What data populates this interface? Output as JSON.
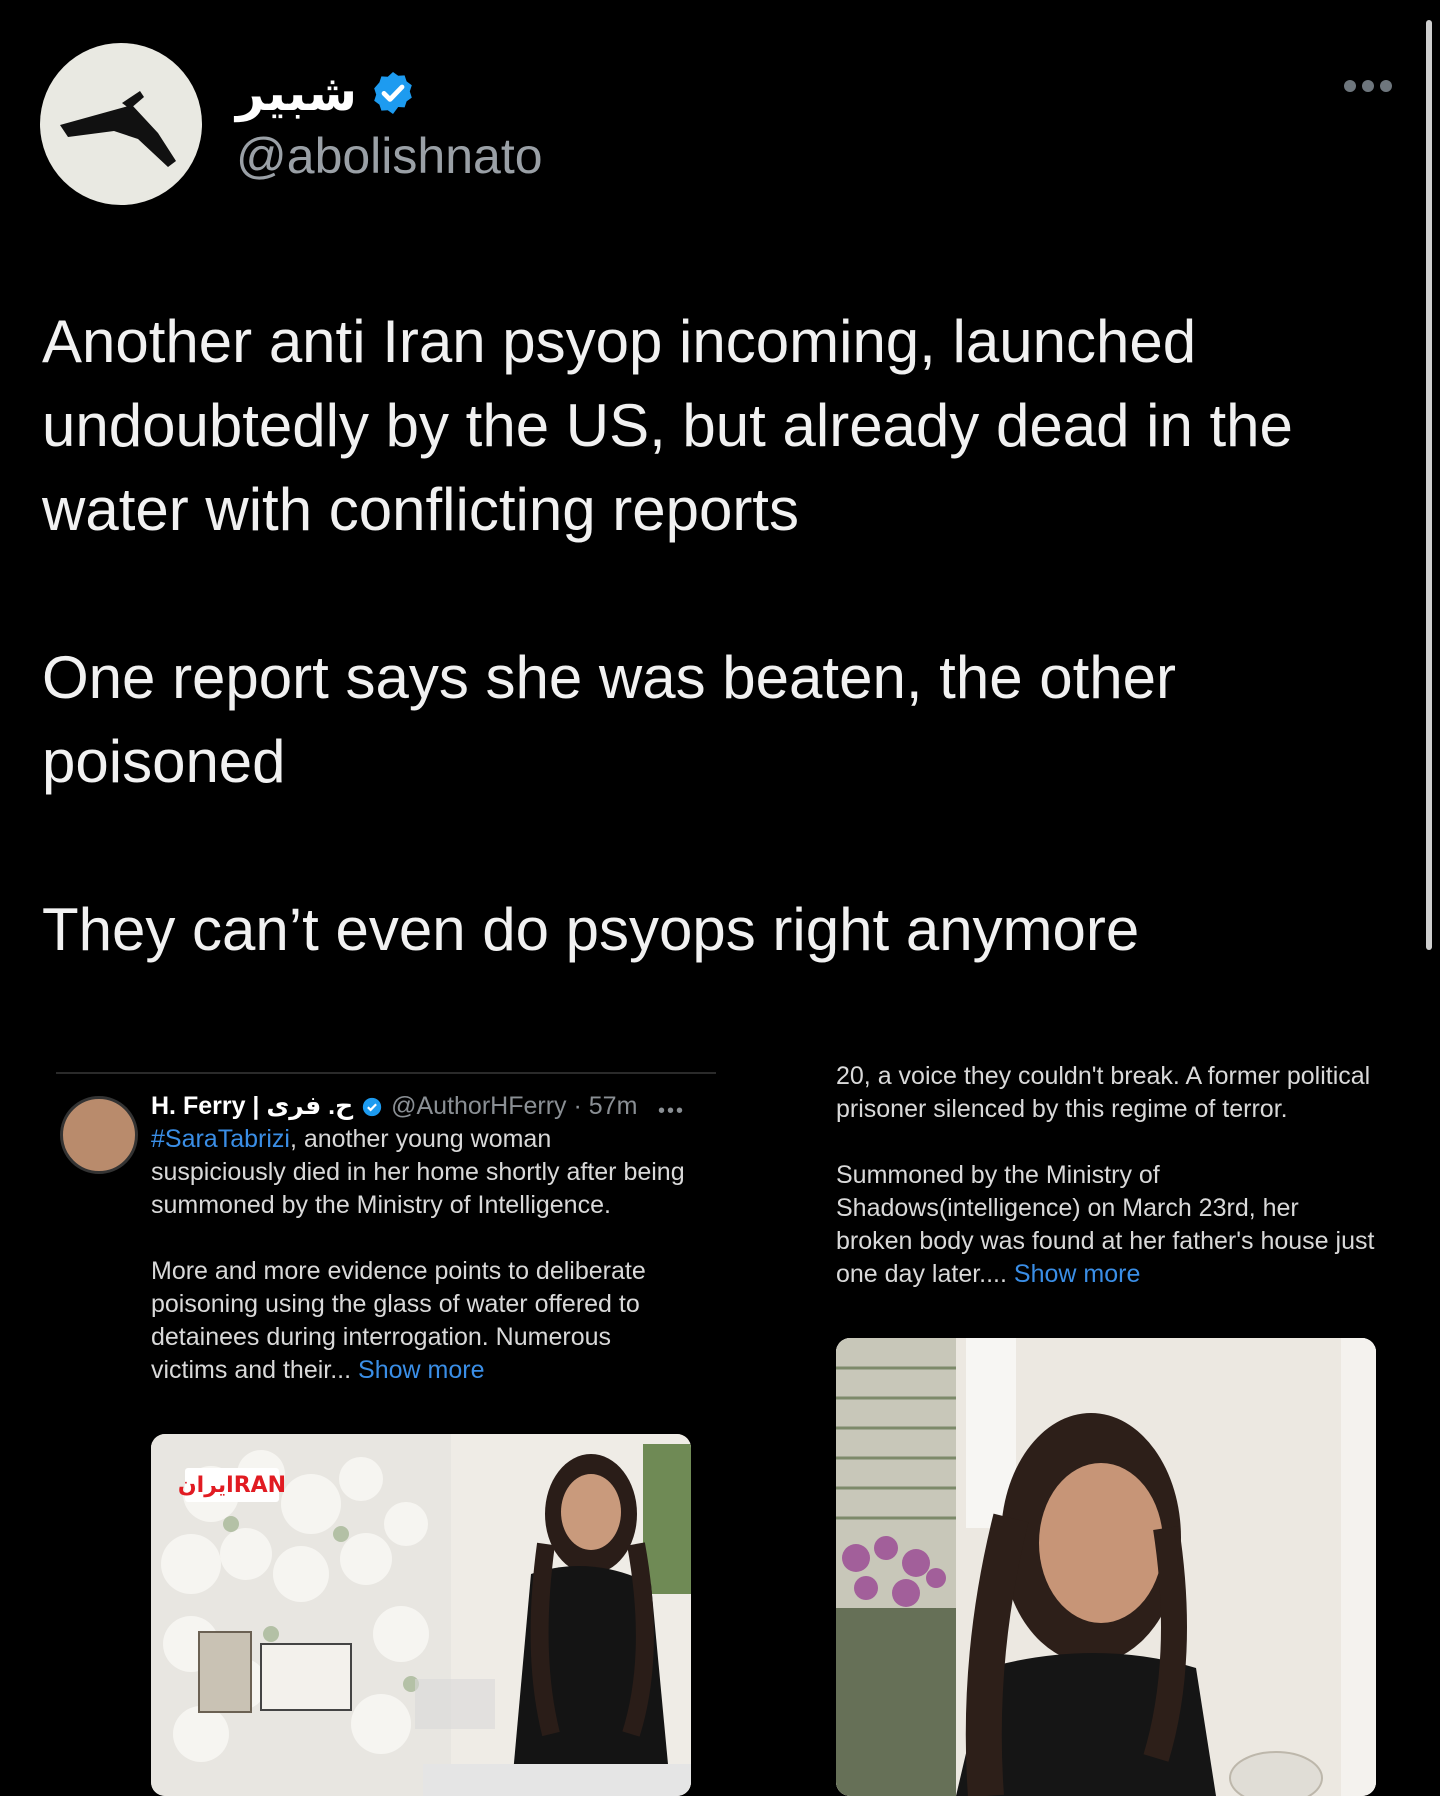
{
  "author": {
    "display_name": "شبير",
    "handle": "@abolishnato",
    "avatar_icon": "drone-silhouette",
    "verified_icon": "verified-badge"
  },
  "tweet": {
    "paragraphs": [
      "Another anti Iran psyop incoming, launched undoubtedly by the US, but already dead in the water with conflicting reports",
      "One report says she was beaten, the other poisoned",
      "They can’t even do psyops right anymore"
    ]
  },
  "embedded_left": {
    "author_name": "H. Ferry | ح. فری",
    "handle_time": "@AuthorHFerry · 57m",
    "hashtag": "#SaraTabrizi",
    "line1_rest": ", another young woman suspiciously died in her home shortly after being summoned by the Ministry of Intelligence.",
    "line2": "More and more evidence points to deliberate poisoning using the glass of water offered to detainees during interrogation. Numerous victims and their...",
    "show_more": "Show more",
    "image_badge": "ایرانRAN"
  },
  "embedded_right": {
    "p1": "20, a voice they couldn't break. A former political prisoner silenced by this regime of terror.",
    "p2": "Summoned by the Ministry of Shadows(intelligence) on March 23rd, her broken body was found at her father's house just one day later....",
    "show_more": "Show more"
  },
  "colors": {
    "background": "#000000",
    "link": "#3a8ee6",
    "verified": "#1d9bf0"
  }
}
